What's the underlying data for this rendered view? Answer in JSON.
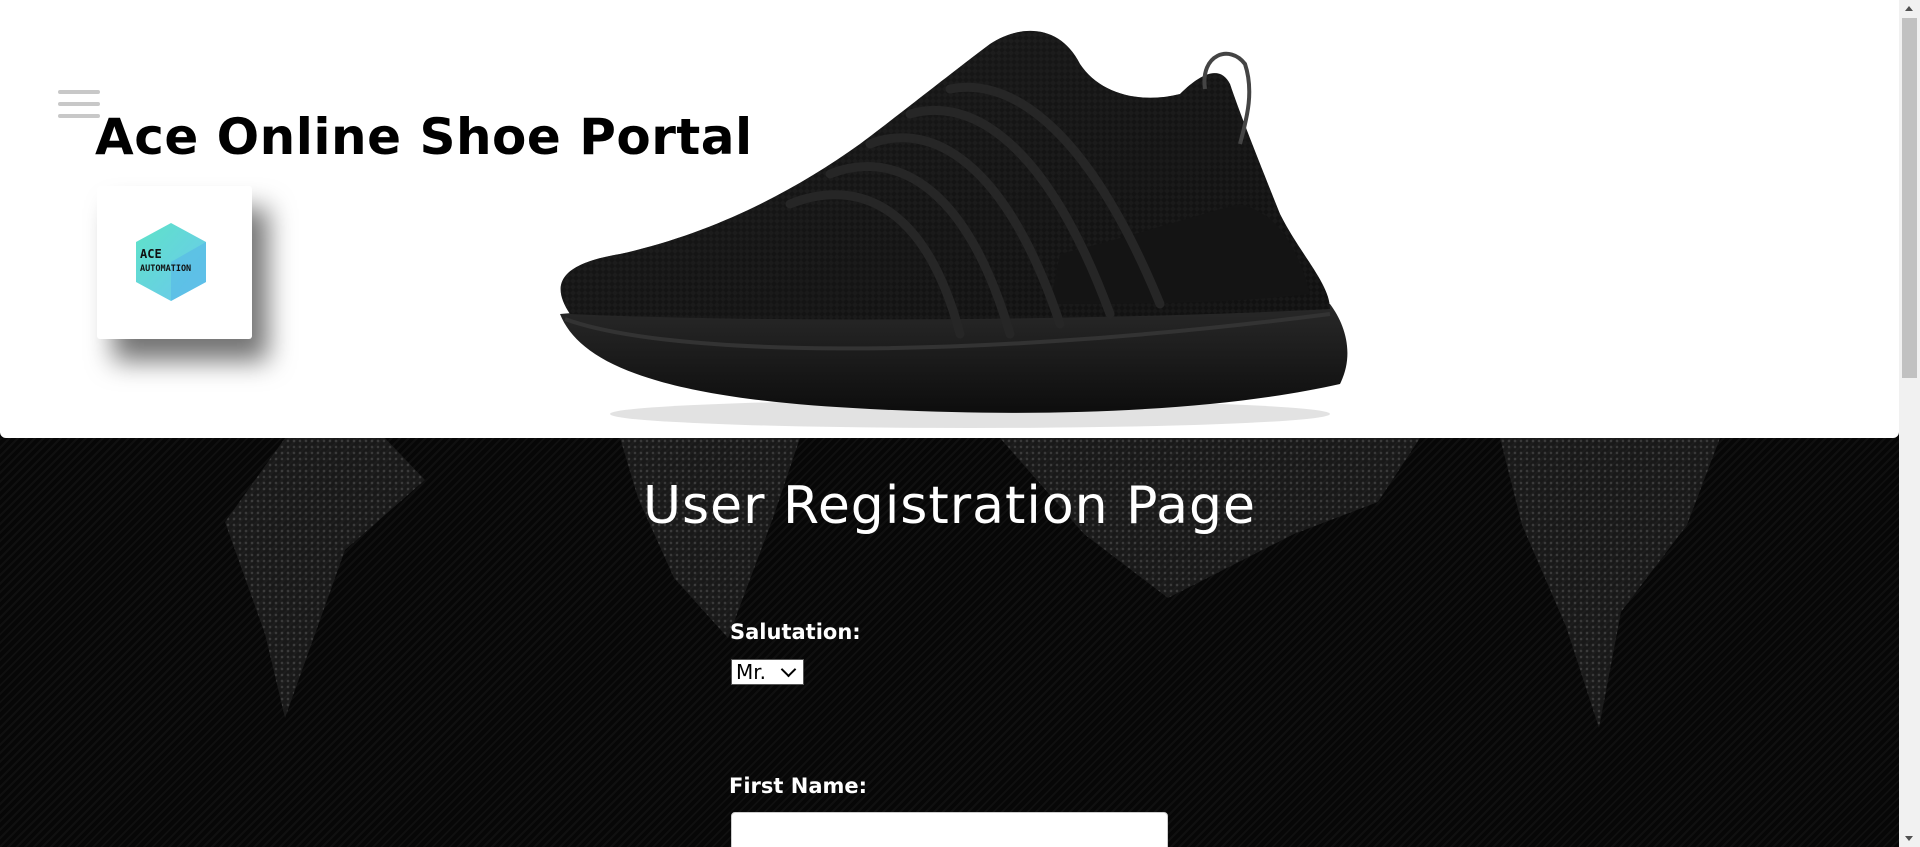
{
  "header": {
    "site_title": "Ace Online Shoe Portal",
    "logo_text_line1": "ACE",
    "logo_text_line2": "AUTOMATION"
  },
  "main": {
    "page_title": "User Registration Page",
    "salutation": {
      "label": "Salutation:",
      "selected": "Mr."
    },
    "first_name": {
      "label": "First Name:",
      "value": ""
    }
  },
  "colors": {
    "header_bg": "#ffffff",
    "page_bg": "#050505",
    "text_light": "#ffffff",
    "logo_teal": "#5ee3c8",
    "logo_blue": "#6cc7ef"
  },
  "icons": {
    "menu": "hamburger-icon"
  }
}
